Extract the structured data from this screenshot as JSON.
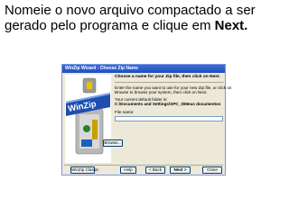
{
  "instruction": {
    "text": "Nomeie o novo arquivo compactado a ser gerado pelo programa e clique em ",
    "emphasis": "Next."
  },
  "window": {
    "title": "WinZip Wizard - Choose Zip Name",
    "heading": "Choose a name for your Zip file, then click on Next.",
    "para1_line1": "Enter the name you want to use for your new Zip file, or click on",
    "para1_line2": "Browse to browse your system, then click on Next.",
    "para2_line1": "Your current default folder is:",
    "para2_line2": "C:\\Documents and Settings\\SPC_3\\Meus documentos",
    "file_name_label": "File name:",
    "file_name_value": "",
    "browse_label": "Browse...",
    "logo_text": "WinZip"
  },
  "buttons": {
    "classic": "WinZip Classic",
    "help": "Help",
    "back": "< Back",
    "next": "Next >",
    "close": "Close"
  },
  "colors": {
    "titlebar": "#1f4fbf",
    "dialog_bg": "#ece9d8",
    "button_border": "#003c74"
  }
}
